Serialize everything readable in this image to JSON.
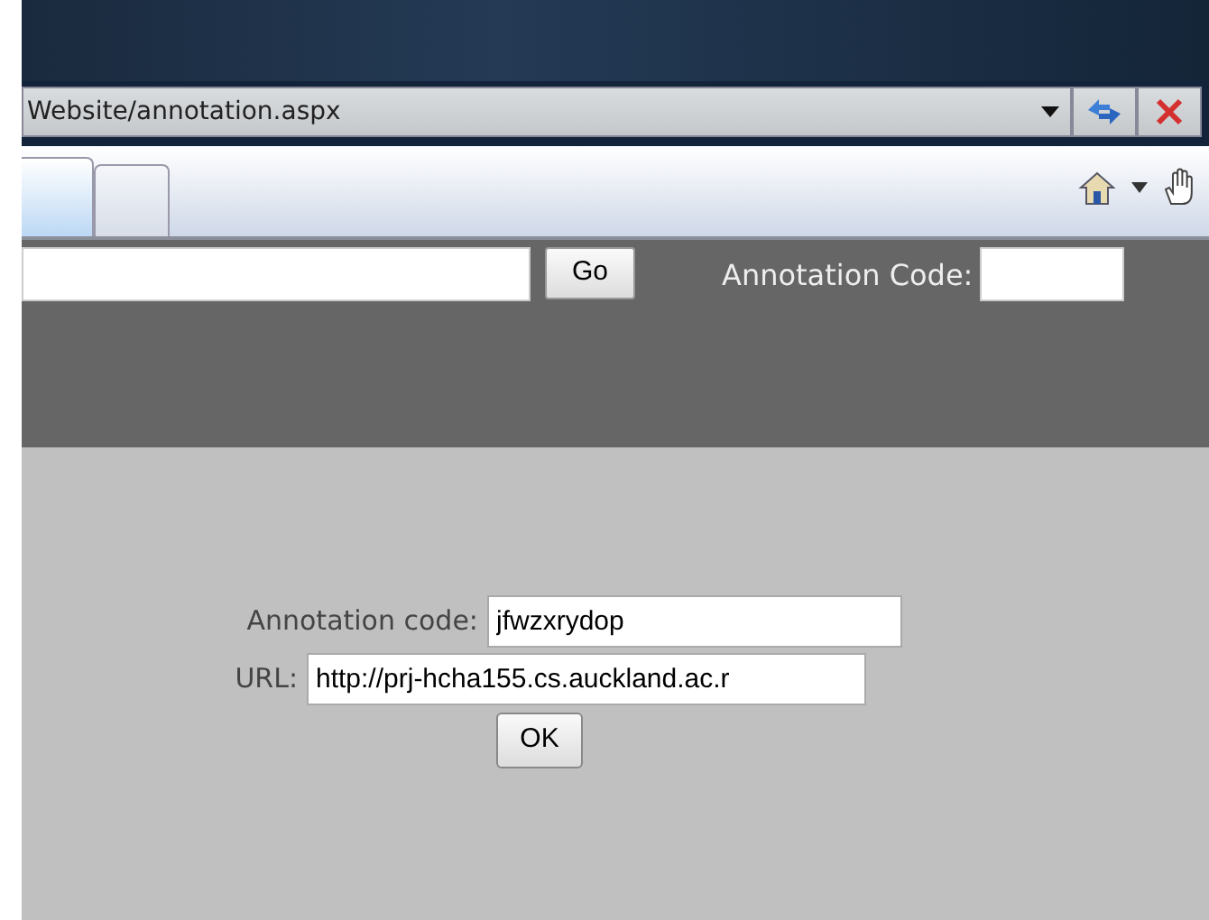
{
  "address_bar": {
    "url": "Website/annotation.aspx"
  },
  "toolbar": {
    "search": {
      "button": "Go"
    },
    "code_label": "Annotation Code:"
  },
  "form": {
    "fields": [
      {
        "label": "Annotation code:",
        "value": "jfwzxrydop"
      },
      {
        "label": "URL:",
        "value": "http://prj-hcha155.cs.auckland.ac.r"
      }
    ],
    "button": "OK"
  }
}
